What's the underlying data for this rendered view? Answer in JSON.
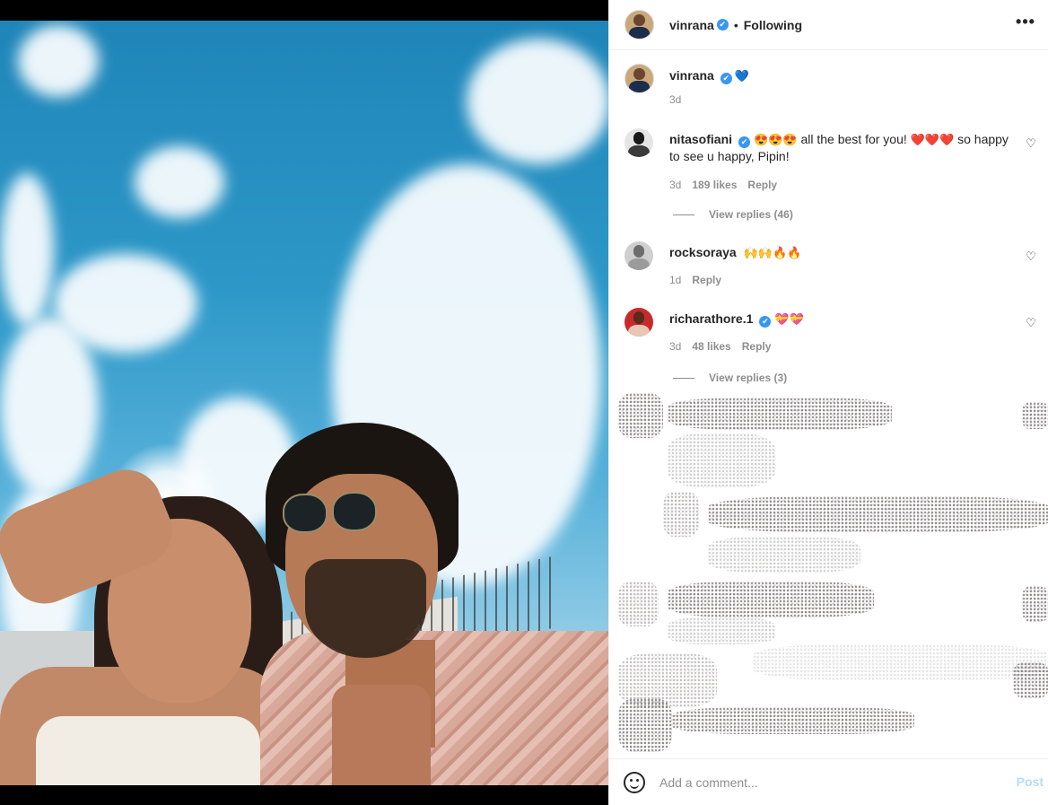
{
  "post_author": {
    "username": "vinrana",
    "follow_status": "Following",
    "separator": "•"
  },
  "caption": {
    "username": "vinrana",
    "text": "💙",
    "time": "3d"
  },
  "comments": [
    {
      "username": "nitasofiani",
      "verified": true,
      "emoji_prefix": "😍😍😍",
      "text_part1": "all the best for you!",
      "hearts": "❤️❤️❤️",
      "text_part2": "so happy to see u happy, Pipin!",
      "time": "3d",
      "likes": "189 likes",
      "reply_label": "Reply",
      "view_replies": "View replies (46)"
    },
    {
      "username": "rocksoraya",
      "verified": false,
      "text": "🙌🙌🔥🔥",
      "time": "1d",
      "reply_label": "Reply"
    },
    {
      "username": "richarathore.1",
      "verified": true,
      "text": "💝💝",
      "time": "3d",
      "likes": "48 likes",
      "reply_label": "Reply",
      "view_replies": "View replies (3)"
    }
  ],
  "footer": {
    "placeholder": "Add a comment...",
    "post_label": "Post"
  },
  "icons": {
    "verified": "✔",
    "heart": "♡",
    "more": "•••"
  },
  "colors": {
    "link_blue": "#3897f0",
    "muted_text": "#8e8e8e",
    "post_disabled": "#b2dffc"
  }
}
